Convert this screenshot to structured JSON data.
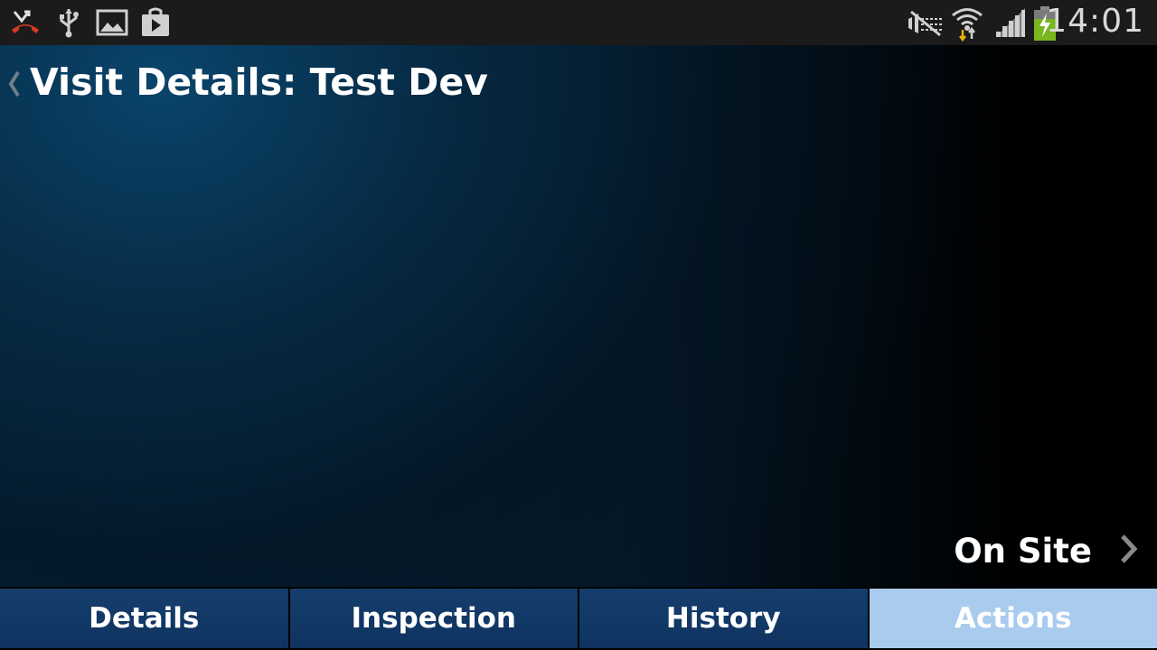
{
  "status_bar": {
    "icons_left": [
      "missed-call-icon",
      "usb-icon",
      "gallery-icon",
      "play-store-icon"
    ],
    "icons_right": [
      "mute-icon",
      "wifi-icon",
      "signal-icon",
      "battery-charging-icon"
    ],
    "time": "14:01"
  },
  "header": {
    "title": "Visit Details: Test Dev",
    "back_icon": "chevron-left-icon"
  },
  "main": {
    "status_link_label": "On Site",
    "status_link_icon": "chevron-right-icon"
  },
  "tabs": [
    {
      "label": "Details",
      "active": false
    },
    {
      "label": "Inspection",
      "active": false
    },
    {
      "label": "History",
      "active": false
    },
    {
      "label": "Actions",
      "active": true
    }
  ],
  "colors": {
    "status_bar_bg": "#1b1b1b",
    "tab_bg": "#153e6c",
    "tab_active_bg": "#a9cbee",
    "battery_green": "#7ab51d"
  }
}
